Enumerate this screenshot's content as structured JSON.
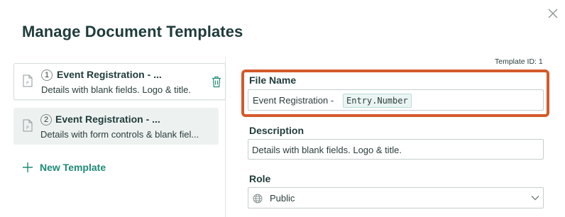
{
  "dialog": {
    "title": "Manage Document Templates",
    "close_icon": "close-icon"
  },
  "templates": [
    {
      "number": "1",
      "name": "Event Registration - ...",
      "description": "Details with blank fields. Logo & title.",
      "selected": true
    },
    {
      "number": "2",
      "name": "Event Registration - ...",
      "description": "Details with form controls & blank fiel..."
    }
  ],
  "new_template_label": "New Template",
  "detail": {
    "template_id": "Template ID: 1",
    "file_name_label": "File Name",
    "file_name_text": "Event Registration -",
    "file_name_token": "Entry.Number",
    "description_label": "Description",
    "description_value": "Details with blank fields. Logo & title.",
    "role_label": "Role",
    "role_value": "Public"
  },
  "colors": {
    "accent": "#1f8a75",
    "highlight": "#d35a2b",
    "heading": "#1f3b3a"
  }
}
